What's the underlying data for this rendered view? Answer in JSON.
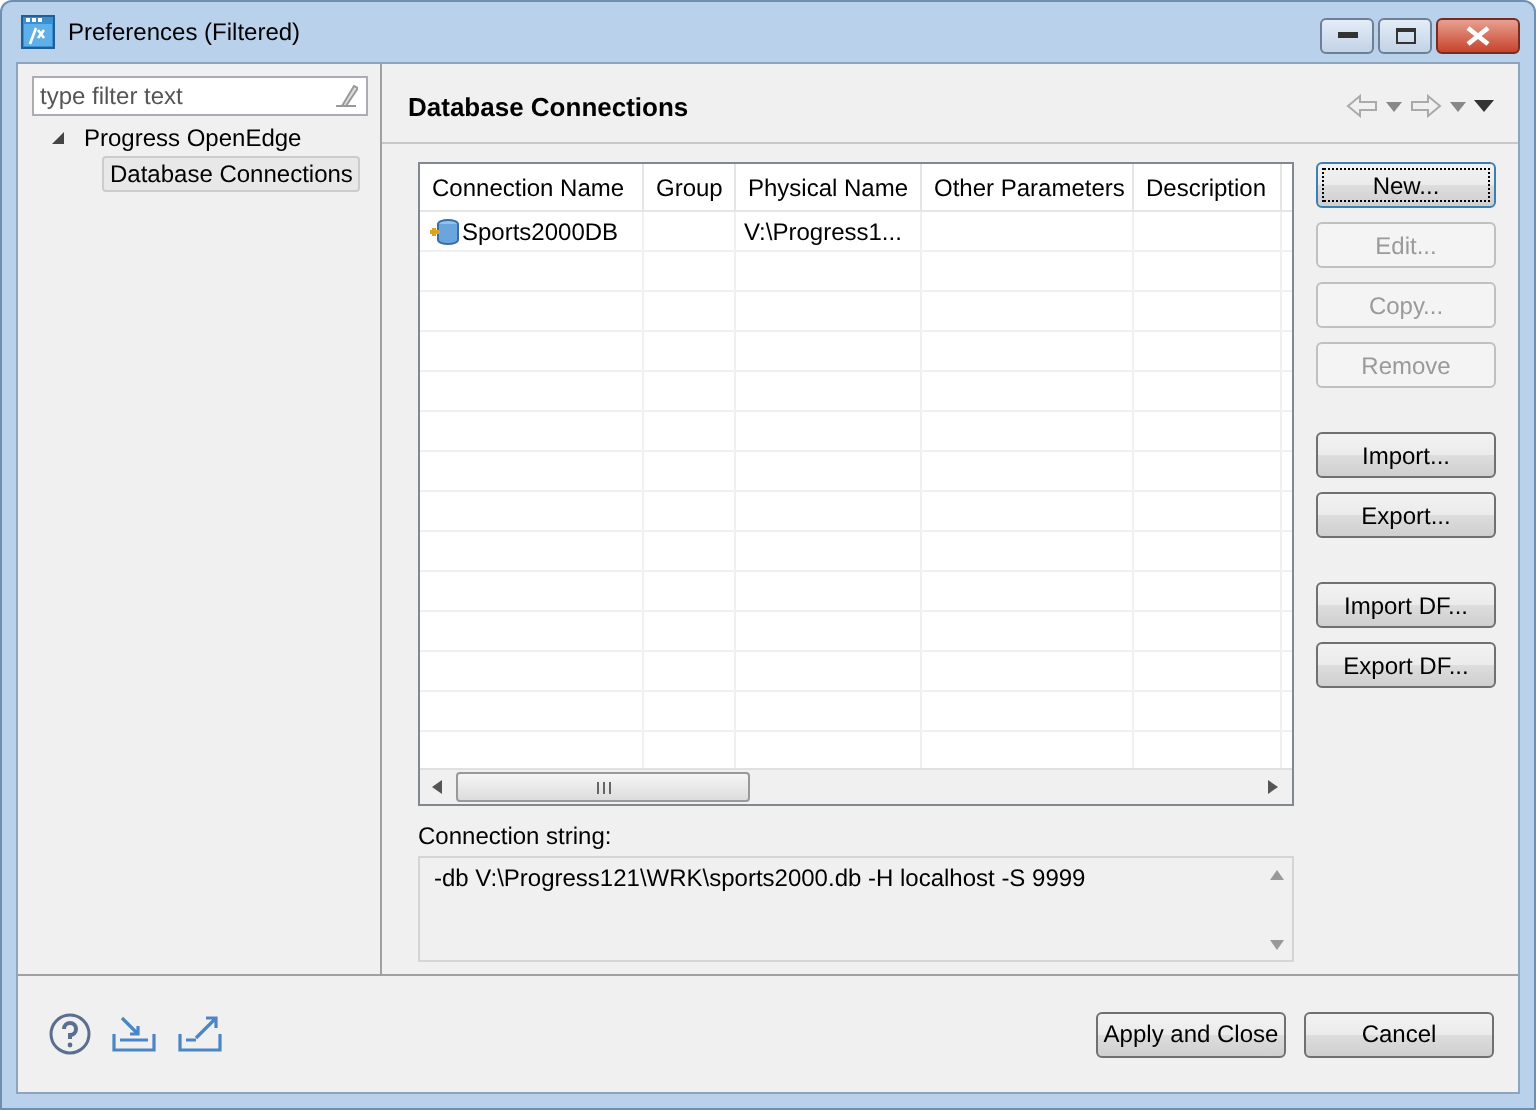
{
  "window": {
    "title": "Preferences (Filtered)"
  },
  "sidebar": {
    "filter": {
      "placeholder": "type filter text"
    },
    "tree": [
      {
        "label": "Progress OpenEdge",
        "expanded": true,
        "selected": false,
        "children": [
          {
            "label": "Database Connections",
            "selected": true
          }
        ]
      }
    ]
  },
  "page": {
    "title": "Database Connections"
  },
  "table": {
    "columns": [
      "Connection Name",
      "Group",
      "Physical Name",
      "Other Parameters",
      "Description"
    ],
    "rows": [
      [
        "Sports2000DB",
        "",
        "V:\\Progress1..."
      ]
    ]
  },
  "button_groups": [
    [
      {
        "label": "New...",
        "disabled": false,
        "focused": true
      },
      {
        "label": "Edit...",
        "disabled": true,
        "focused": false
      },
      {
        "label": "Copy...",
        "disabled": true,
        "focused": false
      },
      {
        "label": "Remove",
        "disabled": true,
        "focused": false
      }
    ],
    [
      {
        "label": "Import...",
        "disabled": false,
        "focused": false
      },
      {
        "label": "Export...",
        "disabled": false,
        "focused": false
      }
    ],
    [
      {
        "label": "Import DF...",
        "disabled": false,
        "focused": false
      },
      {
        "label": "Export DF...",
        "disabled": false,
        "focused": false
      }
    ]
  ],
  "connection_string": {
    "label": "Connection string:",
    "value": "-db V:\\Progress121\\WRK\\sports2000.db -H localhost -S 9999"
  },
  "footer_buttons": [
    "Apply and Close",
    "Cancel"
  ]
}
